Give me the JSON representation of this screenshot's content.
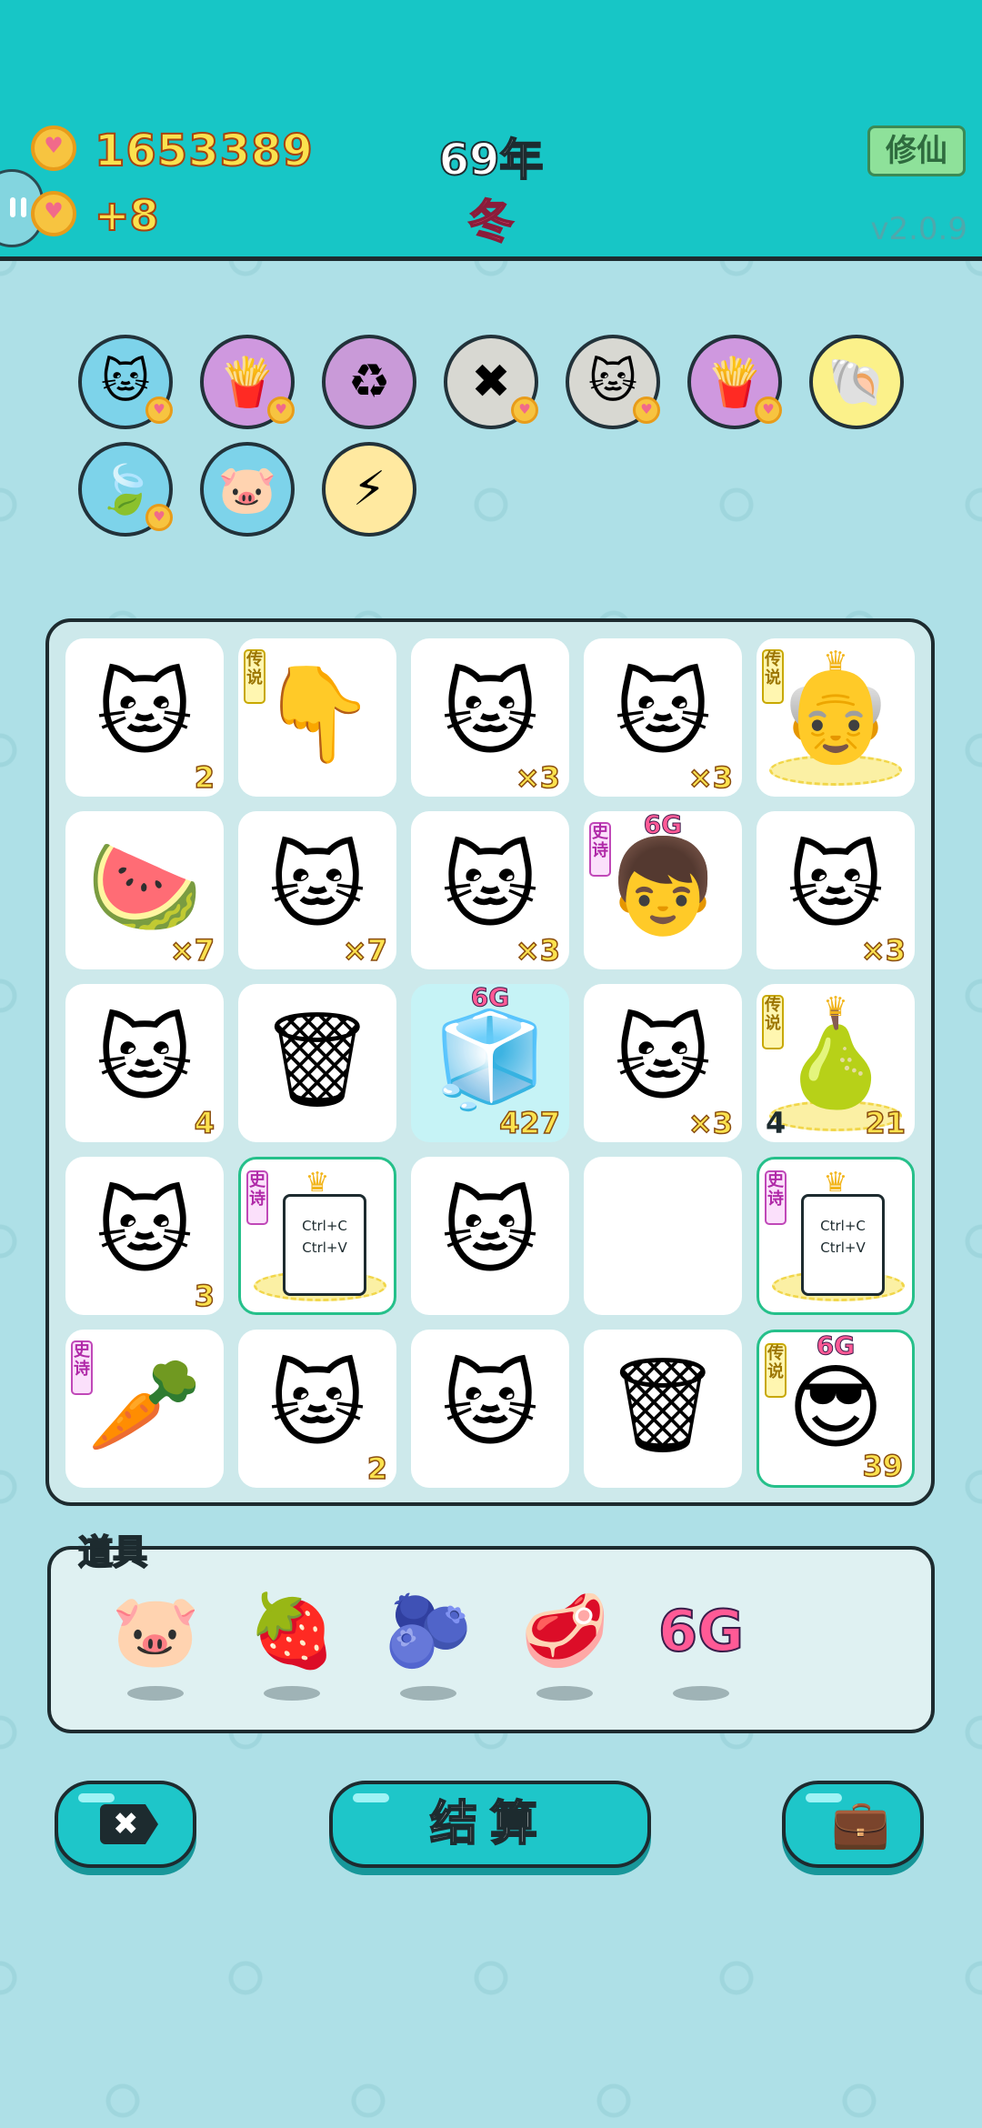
{
  "header": {
    "money": "1653389",
    "income": "+8",
    "year": "69年",
    "season": "冬",
    "xiuxian_label": "修仙",
    "version": "v2.0.9"
  },
  "buffs": [
    {
      "icon": "cat-buff-icon",
      "glyph": "🐱",
      "bg": "#7dd3ea",
      "heart": true
    },
    {
      "icon": "fries-buff-icon",
      "glyph": "🍟",
      "bg": "#cf98df",
      "heart": true
    },
    {
      "icon": "recycle-buff-icon",
      "glyph": "♻",
      "bg": "#c99ad8",
      "heart": false
    },
    {
      "icon": "close-tag-buff-icon",
      "glyph": "✖",
      "bg": "#d8d8d2",
      "heart": true
    },
    {
      "icon": "twin-cats-buff-icon",
      "glyph": "🐱",
      "bg": "#d8d8d2",
      "heart": true
    },
    {
      "icon": "fries-buff-icon",
      "glyph": "🍟",
      "bg": "#cf98df",
      "heart": true
    },
    {
      "icon": "shell-buff-icon",
      "glyph": "🐚",
      "bg": "#fbf18a",
      "heart": false
    },
    {
      "icon": "leaf-buff-icon",
      "glyph": "🍃",
      "bg": "#7dd3ea",
      "heart": true
    },
    {
      "icon": "piggy-buff-icon",
      "glyph": "🐷",
      "bg": "#7dd3ea",
      "heart": false
    },
    {
      "icon": "lightning-buff-icon",
      "glyph": "⚡",
      "bg": "#ffe9a0",
      "heart": false
    }
  ],
  "tag_legend": "传说",
  "tag_epic": "史诗",
  "sixg": "6G",
  "grid": [
    {
      "icon": "cat-icon",
      "glyph": "🐱",
      "count": "2"
    },
    {
      "icon": "pointing-hand-icon",
      "glyph": "👇",
      "count": "",
      "tag": "legend"
    },
    {
      "icon": "cat-icon",
      "glyph": "🐱",
      "count": "×3"
    },
    {
      "icon": "cat-icon",
      "glyph": "🐱",
      "count": "×3"
    },
    {
      "icon": "crowned-old-man-icon",
      "glyph": "👴",
      "count": "",
      "tag": "legend",
      "crown": true,
      "gold": true
    },
    {
      "icon": "watermelon-icon",
      "glyph": "🍉",
      "count": "×7"
    },
    {
      "icon": "cat-icon",
      "glyph": "🐱",
      "count": "×7"
    },
    {
      "icon": "cat-icon",
      "glyph": "🐱",
      "count": "×3"
    },
    {
      "icon": "red-hat-boy-icon",
      "glyph": "👦",
      "count": "",
      "tag": "epic",
      "sixg": true
    },
    {
      "icon": "cat-icon",
      "glyph": "🐱",
      "count": "×3"
    },
    {
      "icon": "cat-icon",
      "glyph": "🐱",
      "count": "4"
    },
    {
      "icon": "trash-bag-icon",
      "glyph": "🗑",
      "count": ""
    },
    {
      "icon": "fridge-icon",
      "glyph": "🧊",
      "count": "427",
      "cyan": true,
      "sixg": true
    },
    {
      "icon": "cat-icon",
      "glyph": "🐱",
      "count": "×3"
    },
    {
      "icon": "crowned-pear-icon",
      "glyph": "🍐",
      "count": "21",
      "lcount": "4",
      "tag": "legend",
      "crown": true,
      "gold": true
    },
    {
      "icon": "cat-icon",
      "glyph": "🐱",
      "count": "3"
    },
    {
      "icon": "ctrl-cv-icon",
      "glyph": "",
      "count": "",
      "tag": "epic",
      "ctrl": true,
      "crown": true,
      "gold": true,
      "hl": true
    },
    {
      "icon": "cat-icon",
      "glyph": "🐱",
      "count": ""
    },
    {
      "icon": "empty-cell",
      "glyph": "",
      "count": ""
    },
    {
      "icon": "ctrl-cv-icon",
      "glyph": "",
      "count": "",
      "tag": "epic",
      "ctrl": true,
      "crown": true,
      "gold": true,
      "hl": true
    },
    {
      "icon": "carrot-icon",
      "glyph": "🥕",
      "count": "",
      "tag": "epic"
    },
    {
      "icon": "cat-icon",
      "glyph": "🐱",
      "count": "2"
    },
    {
      "icon": "cat-icon",
      "glyph": "🐱",
      "count": ""
    },
    {
      "icon": "trash-bag-icon",
      "glyph": "🗑",
      "count": ""
    },
    {
      "icon": "sunglasses-man-icon",
      "glyph": "😎",
      "count": "39",
      "tag": "legend",
      "sixg": true,
      "hl": true
    }
  ],
  "ctrl_text": [
    "Ctrl+C",
    "Ctrl+V"
  ],
  "tools": {
    "title": "道具",
    "items": [
      {
        "icon": "piggy-bank-icon",
        "glyph": "🐷"
      },
      {
        "icon": "strawberry-icon",
        "glyph": "🍓"
      },
      {
        "icon": "blueberry-icon",
        "glyph": "🫐"
      },
      {
        "icon": "liver-icon",
        "glyph": "🥩"
      },
      {
        "icon": "6g-icon",
        "glyph": "6G",
        "text": true
      }
    ]
  },
  "buttons": {
    "close_glyph": "✖",
    "settle_label": "结算",
    "bag_glyph": "💼"
  },
  "colors": {
    "header_bg": "#17c6c6",
    "accent": "#1ec6c9",
    "gold_text": "#fbe24e",
    "season": "#ff5f8a"
  }
}
